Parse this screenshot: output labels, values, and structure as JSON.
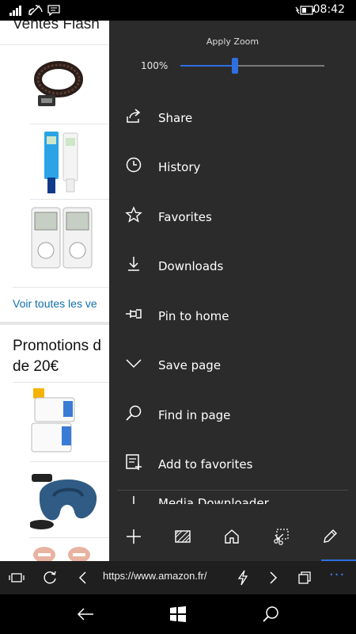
{
  "status_bar": {
    "time": "08:42"
  },
  "page": {
    "flash_title": "Ventes Flash",
    "see_all_link": "Voir toutes les ve",
    "promo_title_line1": "Promotions d",
    "promo_title_line2": "de 20€"
  },
  "menu": {
    "zoom_label": "Apply Zoom",
    "zoom_value": "100%",
    "zoom_level_percent": 38,
    "items": [
      {
        "label": "Share",
        "icon": "share-icon"
      },
      {
        "label": "History",
        "icon": "clock-icon"
      },
      {
        "label": "Favorites",
        "icon": "star-icon"
      },
      {
        "label": "Downloads",
        "icon": "download-icon"
      },
      {
        "label": "Pin to home",
        "icon": "pin-icon"
      },
      {
        "label": "Save page",
        "icon": "chevron-down-icon"
      },
      {
        "label": "Find in page",
        "icon": "magnifier-icon"
      },
      {
        "label": "Add to favorites",
        "icon": "add-favorite-icon"
      },
      {
        "label": "Media Downloader",
        "icon": "media-download-icon"
      }
    ],
    "bottom_icons": [
      "plus-icon",
      "hatched-tab-icon",
      "home-icon",
      "screenshot-icon",
      "pencil-icon"
    ]
  },
  "address_bar": {
    "url": "https://www.amazon.fr/",
    "more": "···"
  },
  "colors": {
    "accent": "#2f6fe0",
    "menu_bg": "#2b2b2b",
    "link": "#0f6fab"
  }
}
